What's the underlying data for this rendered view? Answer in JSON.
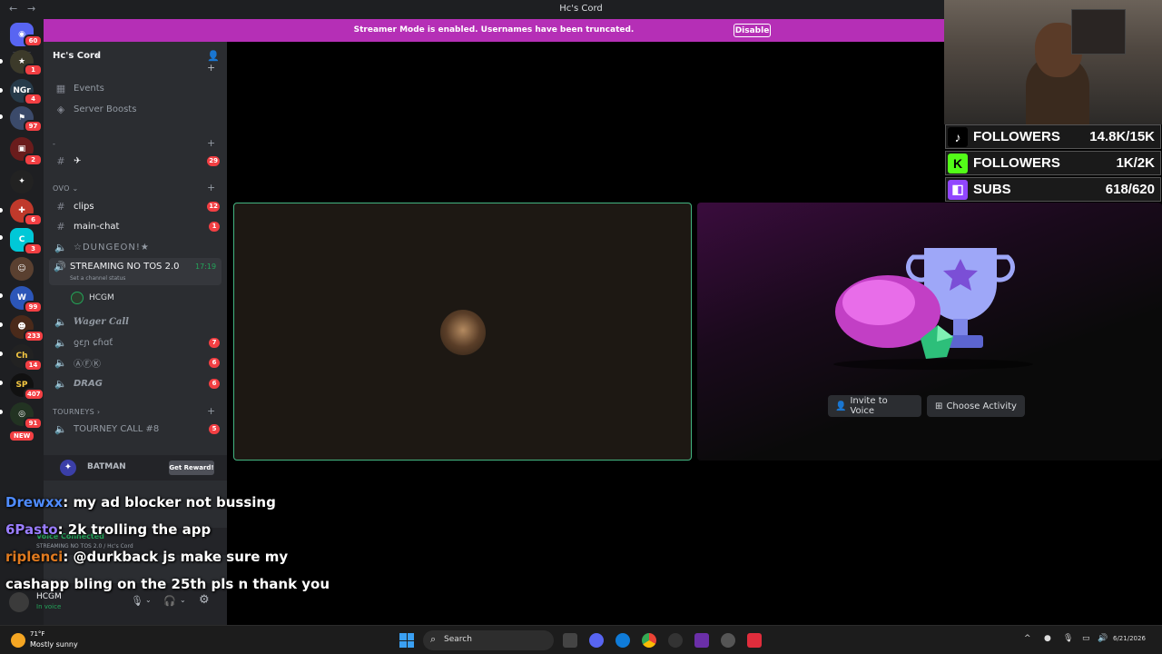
{
  "window": {
    "title": "Hc's Cord"
  },
  "banner": {
    "text": "Streamer Mode is enabled. Usernames have been truncated.",
    "button": "Disable"
  },
  "server": {
    "name": "Hc's Cord"
  },
  "server_rail": {
    "badges": [
      "60",
      "1",
      "4",
      "97",
      "2",
      "6",
      "3",
      "99",
      "233",
      "14",
      "407",
      "91",
      "NEW"
    ]
  },
  "sidebar": {
    "events": "Events",
    "boosts": "Server Boosts",
    "category1": "-",
    "channel_plane": "✈",
    "channel_plane_count": "29",
    "category_ovo": "OVO",
    "clips": "clips",
    "clips_count": "12",
    "main_chat": "main-chat",
    "main_chat_count": "1",
    "dungeon": "☆DUNGEON!★",
    "streaming": "STREAMING NO TOS 2.0",
    "streaming_time": "17:19",
    "streaming_status": "Set a channel status",
    "voice_user": "HCGM",
    "wager": "Wager Call",
    "gen_chat": "ƍɛɲ ɕɦɑƭ",
    "gen_chat_count": "7",
    "afk": "ⒶⒻⓀ",
    "afk_count": "6",
    "drag": "DRAG",
    "drag_count": "6",
    "category_tourneys": "TOURNEYS",
    "tourney": "TOURNEY CALL #8",
    "tourney_count": "5"
  },
  "reward": {
    "label": "BATMAN",
    "button": "Get Reward!"
  },
  "voice_panel": {
    "status": "Voice Connected",
    "channel": "STREAMING NO TOS 2.0 / Hc's Cord"
  },
  "user_panel": {
    "name": "HCGM",
    "status": "In voice"
  },
  "stage": {
    "invite": "Invite to Voice",
    "activity": "Choose Activity"
  },
  "stream_stats": [
    {
      "label": "FOLLOWERS",
      "value": "14.8K/15K",
      "icon": "tiktok-icon",
      "color": "#000000"
    },
    {
      "label": "FOLLOWERS",
      "value": "1K/2K",
      "icon": "kick-icon",
      "color": "#53fc18"
    },
    {
      "label": "SUBS",
      "value": "618/620",
      "icon": "twitch-icon",
      "color": "#9146ff"
    }
  ],
  "chat": [
    {
      "user": "Drewxx",
      "color": "#4f8cff",
      "msg": "my ad blocker not bussing"
    },
    {
      "user": "6Pasto",
      "color": "#9a7dff",
      "msg": "2k trolling the app"
    },
    {
      "user": "riplenci",
      "color": "#e07a1f",
      "msg": "@durkback js make sure my"
    },
    {
      "user": "",
      "color": "#ffffff",
      "msg": "cashapp bling on the 25th pls n thank you"
    }
  ],
  "taskbar": {
    "weather_temp": "71°F",
    "weather_desc": "Mostly sunny",
    "search": "Search",
    "date": "6/21/2026"
  }
}
